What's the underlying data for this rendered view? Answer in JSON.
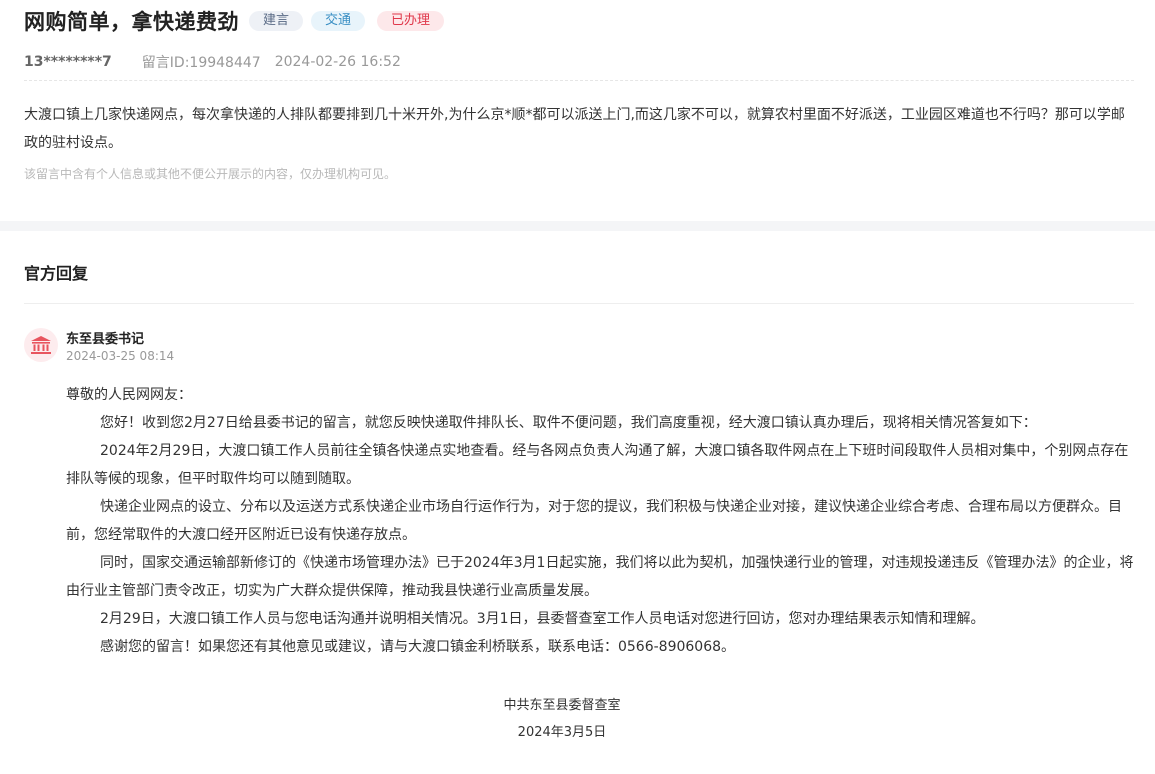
{
  "post": {
    "title": "网购简单，拿快递费劲",
    "tags": [
      "建言",
      "交通",
      "已办理"
    ],
    "user": "13********7",
    "id_text": "留言ID:19948447",
    "time": "2024-02-26 16:52",
    "content": "大渡口镇上几家快递网点，每次拿快递的人排队都要排到几十米开外,为什么京*顺*都可以派送上门,而这几家不可以，就算农村里面不好派送，工业园区难道也不行吗？那可以学邮政的驻村设点。",
    "notice": "该留言中含有个人信息或其他不便公开展示的内容，仅办理机构可见。"
  },
  "official": {
    "section_title": "官方回复",
    "org_icon": "government-building-icon",
    "org_name": "东至县委书记",
    "org_time": "2024-03-25 08:14",
    "greeting": "尊敬的人民网网友：",
    "paragraphs": [
      "您好！收到您2月27日给县委书记的留言，就您反映快递取件排队长、取件不便问题，我们高度重视，经大渡口镇认真办理后，现将相关情况答复如下：",
      "2024年2月29日，大渡口镇工作人员前往全镇各快递点实地查看。经与各网点负责人沟通了解，大渡口镇各取件网点在上下班时间段取件人员相对集中，个别网点存在排队等候的现象，但平时取件均可以随到随取。",
      "快递企业网点的设立、分布以及运送方式系快递企业市场自行运作行为，对于您的提议，我们积极与快递企业对接，建议快递企业综合考虑、合理布局以方便群众。目前，您经常取件的大渡口经开区附近已设有快递存放点。",
      "同时，国家交通运输部新修订的《快递市场管理办法》已于2024年3月1日起实施，我们将以此为契机，加强快递行业的管理，对违规投递违反《管理办法》的企业，将由行业主管部门责令改正，切实为广大群众提供保障，推动我县快递行业高质量发展。",
      "2月29日，大渡口镇工作人员与您电话沟通并说明相关情况。3月1日，县委督查室工作人员电话对您进行回访，您对办理结果表示知情和理解。",
      "感谢您的留言！如果您还有其他意见或建议，请与大渡口镇金利桥联系，联系电话：0566-8906068。"
    ],
    "signature_org": "中共东至县委督查室",
    "signature_date": "2024年3月5日"
  },
  "colors": {
    "tag_gray": "#5a6b86",
    "tag_blue": "#3a8fc4",
    "tag_red": "#e0384b",
    "icon_red": "#e8555f"
  }
}
